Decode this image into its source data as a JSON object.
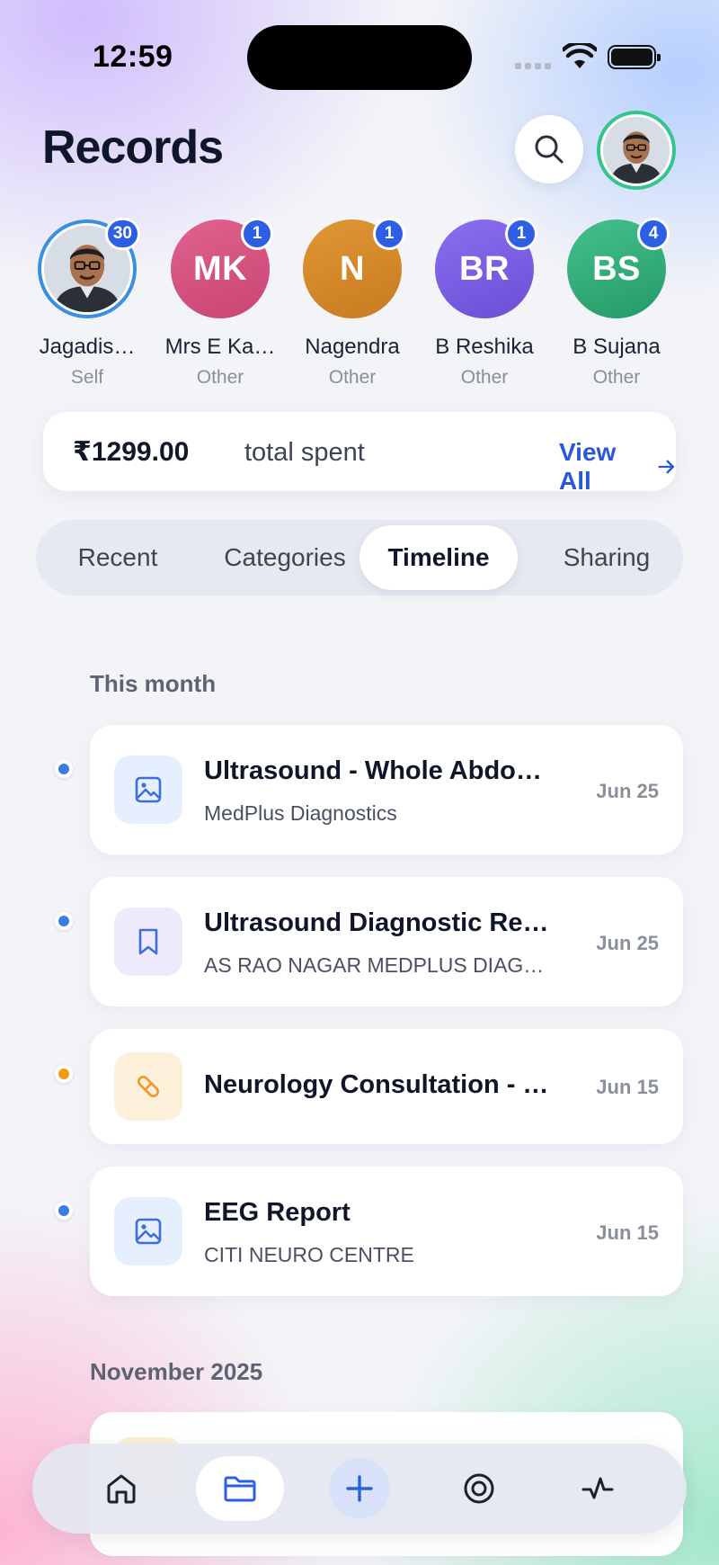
{
  "status_bar": {
    "time": "12:59"
  },
  "header": {
    "title": "Records"
  },
  "profiles": [
    {
      "name": "Jagadis…",
      "relation": "Self",
      "count": "30",
      "initials": "",
      "color": "#3a90e0"
    },
    {
      "name": "Mrs E Ka…",
      "relation": "Other",
      "count": "1",
      "initials": "MK",
      "color": "#d94f82"
    },
    {
      "name": "Nagendra",
      "relation": "Other",
      "count": "1",
      "initials": "N",
      "color": "#d6892a"
    },
    {
      "name": "B Reshika",
      "relation": "Other",
      "count": "1",
      "initials": "BR",
      "color": "#7b60e2"
    },
    {
      "name": "B Sujana",
      "relation": "Other",
      "count": "4",
      "initials": "BS",
      "color": "#33b07c"
    }
  ],
  "spend": {
    "amount": "₹1299.00",
    "label": "total spent",
    "view_all": "View All"
  },
  "tabs": [
    "Recent",
    "Categories",
    "Timeline",
    "Sharing"
  ],
  "active_tab": "Timeline",
  "timeline": {
    "sections": [
      {
        "label": "This month"
      },
      {
        "label": "November 2025"
      }
    ],
    "records": [
      {
        "title": "Ultrasound - Whole Abdo…",
        "subtitle": "MedPlus Diagnostics",
        "date": "Jun 25",
        "icon": "image-icon",
        "dot_color": "#3b7de8"
      },
      {
        "title": "Ultrasound Diagnostic Re…",
        "subtitle": "AS RAO NAGAR MEDPLUS DIAG…",
        "date": "Jun 25",
        "icon": "bookmark-icon",
        "dot_color": "#3b7de8"
      },
      {
        "title": "Neurology Consultation - …",
        "subtitle": "",
        "date": "Jun 15",
        "icon": "pill-icon",
        "dot_color": "#f29b12"
      },
      {
        "title": "EEG Report",
        "subtitle": "CITI NEURO CENTRE",
        "date": "Jun 15",
        "icon": "image-icon",
        "dot_color": "#3b7de8"
      }
    ]
  },
  "bottom_nav": [
    "home-icon",
    "folder-icon",
    "plus-icon",
    "target-icon",
    "activity-icon"
  ]
}
